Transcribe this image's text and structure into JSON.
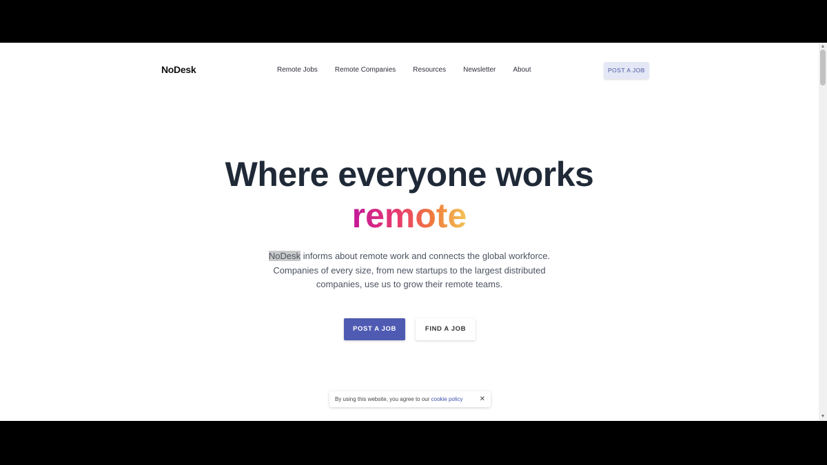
{
  "header": {
    "logo": "NoDesk",
    "nav": [
      "Remote Jobs",
      "Remote Companies",
      "Resources",
      "Newsletter",
      "About"
    ],
    "cta_label": "POST A JOB"
  },
  "hero": {
    "title": "Where everyone works",
    "accent": "remote",
    "accent_gradient": [
      "#c2189a",
      "#e83a6e",
      "#f07a3c",
      "#f2c457"
    ],
    "desc_highlight": "NoDesk",
    "desc_line1_rest": " informs about remote work and connects the global workforce.",
    "desc_line2": "Companies of every size, from new startups to the largest distributed",
    "desc_line3": "companies, use us to grow their remote teams.",
    "primary_button": "POST A JOB",
    "secondary_button": "FIND A JOB"
  },
  "cookie": {
    "text": "By using this website, you agree to our ",
    "link": "cookie policy",
    "close": "✕"
  },
  "colors": {
    "accent": "#4f5bb3",
    "text_dark": "#1f2937"
  }
}
